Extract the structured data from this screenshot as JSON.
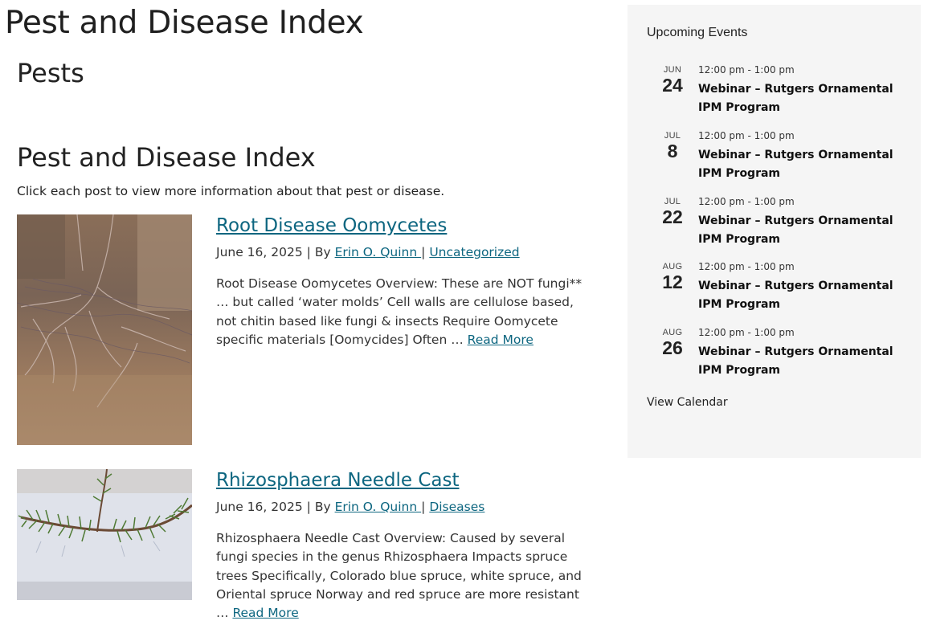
{
  "page": {
    "title": "Pest and Disease Index"
  },
  "section": {
    "title": "Pests"
  },
  "index": {
    "title": "Pest and Disease Index",
    "intro": "Click each post to view more information about that pest or disease."
  },
  "posts": [
    {
      "title": "Root Disease Oomycetes ",
      "date": "June 16, 2025",
      "by_label": "By",
      "author": "Erin O. Quinn ",
      "separator": "|",
      "category": "Uncategorized",
      "excerpt": "Root Disease Oomycetes  Overview: These are NOT fungi** … but called ‘water molds’ Cell walls are cellulose based, not chitin based like fungi & insects Require Oomycete specific materials [Oomycides] Often …",
      "read_more": "Read More",
      "image": "soil-roots-photo"
    },
    {
      "title": "Rhizosphaera Needle Cast",
      "date": "June 16, 2025",
      "by_label": "By",
      "author": "Erin O. Quinn ",
      "separator": "|",
      "category": "Diseases",
      "excerpt": "Rhizosphaera Needle Cast Overview: Caused by several fungi species in the genus Rhizosphaera Impacts spruce trees Specifically, Colorado blue spruce, white spruce, and Oriental spruce Norway and red spruce are more resistant  …",
      "read_more": "Read More",
      "image": "spruce-branch-photo"
    }
  ],
  "sidebar": {
    "title": "Upcoming Events",
    "events": [
      {
        "month": "JUN",
        "day": "24",
        "time": "12:00 pm - 1:00 pm",
        "title": "Webinar – Rutgers Ornamental IPM Program"
      },
      {
        "month": "JUL",
        "day": "8",
        "time": "12:00 pm - 1:00 pm",
        "title": "Webinar – Rutgers Ornamental IPM Program"
      },
      {
        "month": "JUL",
        "day": "22",
        "time": "12:00 pm - 1:00 pm",
        "title": "Webinar – Rutgers Ornamental IPM Program"
      },
      {
        "month": "AUG",
        "day": "12",
        "time": "12:00 pm - 1:00 pm",
        "title": "Webinar – Rutgers Ornamental IPM Program"
      },
      {
        "month": "AUG",
        "day": "26",
        "time": "12:00 pm - 1:00 pm",
        "title": "Webinar – Rutgers Ornamental IPM Program"
      }
    ],
    "view_calendar": "View Calendar"
  },
  "colors": {
    "link": "#0d6680",
    "sidebar_bg": "#f5f5f5"
  }
}
